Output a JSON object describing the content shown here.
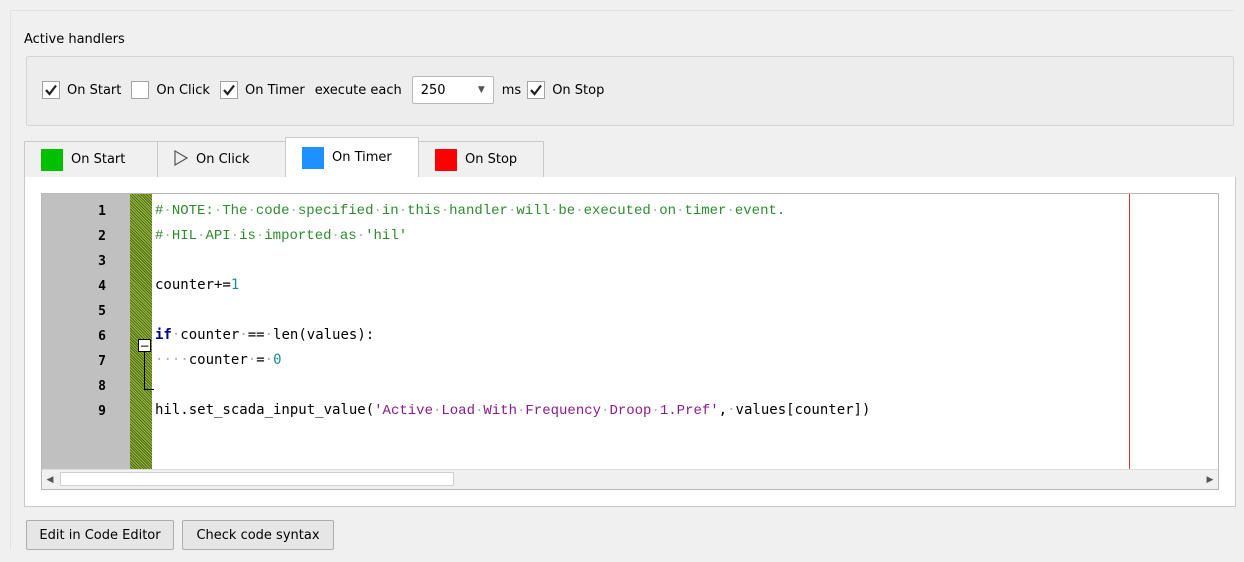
{
  "section_title": "Active handlers",
  "handlers": {
    "on_start": {
      "label": "On Start",
      "checked": true
    },
    "on_click": {
      "label": "On Click",
      "checked": false
    },
    "on_timer": {
      "label": "On Timer",
      "checked": true
    },
    "execute_each_label": "execute each",
    "interval_value": "250",
    "interval_unit": "ms",
    "on_stop": {
      "label": "On Stop",
      "checked": true
    }
  },
  "tabs": [
    {
      "label": "On Start",
      "color": "#00c000",
      "icon": "green-square-icon"
    },
    {
      "label": "On Click",
      "icon": "play-outline-icon"
    },
    {
      "label": "On Timer",
      "color": "#1e90ff",
      "icon": "blue-square-icon",
      "active": true
    },
    {
      "label": "On Stop",
      "color": "#ff0000",
      "icon": "red-square-icon"
    }
  ],
  "editor": {
    "line_numbers": [
      "1",
      "2",
      "3",
      "4",
      "5",
      "6",
      "7",
      "8",
      "9"
    ],
    "lines": [
      "# NOTE: The code specified in this handler will be executed on timer event.",
      "# HIL API is imported as 'hil'",
      "",
      "counter+=1",
      "",
      "if counter == len(values):",
      "    counter = 0",
      "",
      "hil.set_scada_input_value('Active Load With Frequency Droop 1.Pref', values[counter])"
    ]
  },
  "buttons": {
    "edit": "Edit in Code Editor",
    "check": "Check code syntax"
  }
}
